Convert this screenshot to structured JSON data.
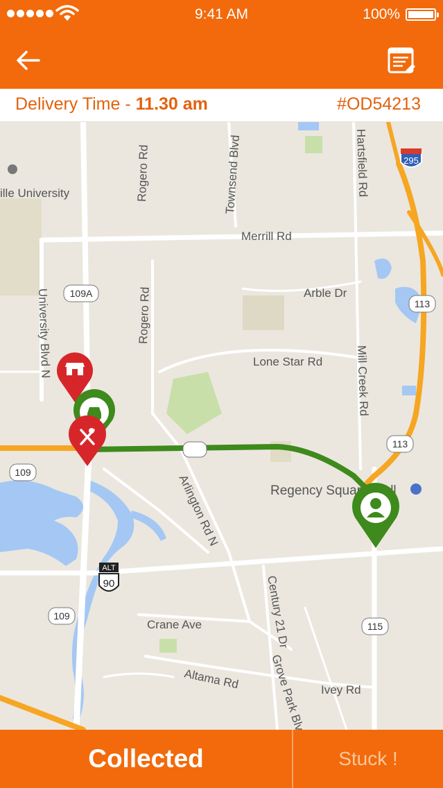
{
  "status_bar": {
    "time": "9:41 AM",
    "battery": "100%",
    "icons": [
      "signal-dots-icon",
      "wifi-icon",
      "battery-icon"
    ]
  },
  "app_bar": {
    "icons": [
      "back-arrow-icon",
      "order-details-icon"
    ]
  },
  "info_bar": {
    "delivery_label": "Delivery Time - ",
    "delivery_time": "11.30 am",
    "order_id": "#OD54213"
  },
  "map": {
    "labels": {
      "university": "ille University",
      "merrill": "Merrill Rd",
      "arble": "Arble Dr",
      "lone_star": "Lone Star Rd",
      "rogero_top": "Rogero Rd",
      "rogero": "Rogero Rd",
      "townsend": "Townsend Blvd",
      "hartsfield": "Hartsfield Rd",
      "university_blvd": "University Blvd N",
      "mill_creek": "Mill Creek Rd",
      "regency": "Regency Square Mall",
      "arlington": "Arlington Rd N",
      "crane": "Crane Ave",
      "century": "Century 21 Dr",
      "grove_park": "Grove Park Blvd",
      "altama": "Altama Rd",
      "ivey": "Ivey Rd"
    },
    "shields": {
      "i295": "295",
      "r109a": "109A",
      "r113_top": "113",
      "r113": "113",
      "r109": "109",
      "r109_b": "109",
      "r115": "115",
      "alt": "ALT",
      "r90": "90"
    },
    "markers": [
      "store-marker-icon",
      "car-marker-icon",
      "restaurant-marker-icon",
      "customer-marker-icon"
    ],
    "colors": {
      "route": "#3e8a1c",
      "highway": "#f6a623",
      "water": "#a4c8f3",
      "park": "#c9dfa9"
    }
  },
  "actions": {
    "collected_label": "Collected",
    "stuck_label": "Stuck !"
  },
  "colors": {
    "primary": "#f26a0c",
    "accent_text": "#e2620e"
  }
}
